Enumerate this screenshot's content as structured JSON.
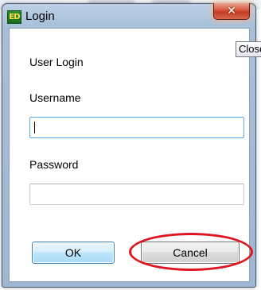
{
  "window": {
    "title": "Login",
    "app_icon_text": "ED",
    "close_glyph": "✕"
  },
  "tooltip": {
    "text": "Close"
  },
  "form": {
    "heading": "User Login",
    "username_label": "Username",
    "username_value": "",
    "password_label": "Password",
    "password_value": ""
  },
  "buttons": {
    "ok_label": "OK",
    "cancel_label": "Cancel"
  },
  "annotation": {
    "highlight_color": "#e0141e",
    "highlight_target": "cancel-button"
  }
}
